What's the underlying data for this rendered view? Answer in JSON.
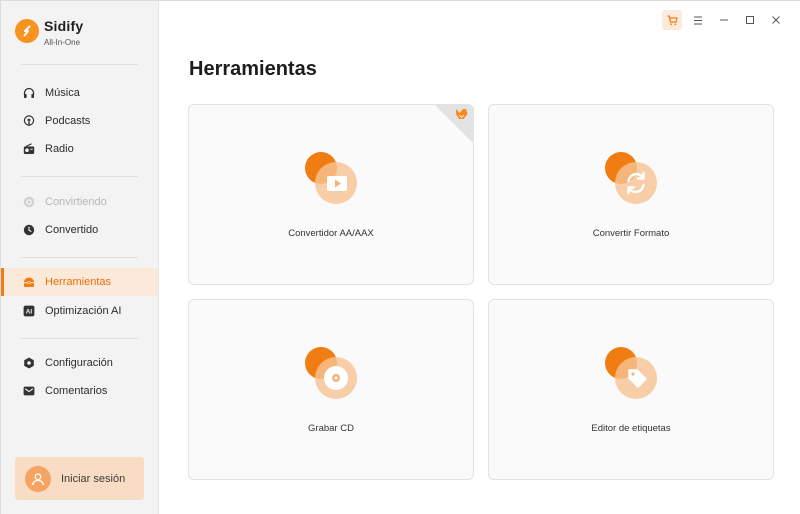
{
  "app": {
    "name": "Sidify",
    "subtitle": "All-In-One"
  },
  "colors": {
    "accent": "#f27a12",
    "accent_light": "#fbe9d9",
    "icon_orange": "#f07d12",
    "icon_peach": "#f8c393"
  },
  "sidebar": {
    "items": [
      {
        "label": "Música",
        "icon": "headphones-icon",
        "state": "normal"
      },
      {
        "label": "Podcasts",
        "icon": "podcast-icon",
        "state": "normal"
      },
      {
        "label": "Radio",
        "icon": "radio-icon",
        "state": "normal"
      },
      {
        "label": "Convirtiendo",
        "icon": "converting-icon",
        "state": "disabled"
      },
      {
        "label": "Convertido",
        "icon": "clock-icon",
        "state": "normal"
      },
      {
        "label": "Herramientas",
        "icon": "toolbox-icon",
        "state": "active"
      },
      {
        "label": "Optimización AI",
        "icon": "ai-icon",
        "state": "normal"
      },
      {
        "label": "Configuración",
        "icon": "gear-icon",
        "state": "normal"
      },
      {
        "label": "Comentarios",
        "icon": "mail-icon",
        "state": "normal"
      }
    ],
    "login": {
      "label": "Iniciar sesión",
      "icon": "user-icon"
    }
  },
  "window_controls": [
    "cart-icon",
    "menu-icon",
    "minimize-icon",
    "maximize-icon",
    "close-icon"
  ],
  "main": {
    "title": "Herramientas",
    "tools": [
      {
        "label": "Convertidor AA/AAX",
        "icon": "video-play-icon",
        "badge": "fox-badge-icon"
      },
      {
        "label": "Convertir Formato",
        "icon": "refresh-icon"
      },
      {
        "label": "Grabar CD",
        "icon": "disc-icon"
      },
      {
        "label": "Editor de etiquetas",
        "icon": "tag-icon"
      }
    ]
  }
}
